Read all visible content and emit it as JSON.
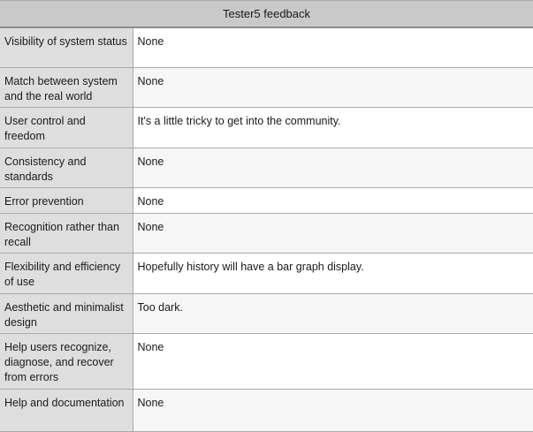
{
  "table": {
    "title": "Tester5 feedback",
    "rows": [
      {
        "heuristic": "Visibility of system status",
        "feedback": "None"
      },
      {
        "heuristic": "Match between system and the real world",
        "feedback": "None"
      },
      {
        "heuristic": "User control and freedom",
        "feedback": "It's a little tricky to get into the community."
      },
      {
        "heuristic": "Consistency and standards",
        "feedback": "None"
      },
      {
        "heuristic": "Error prevention",
        "feedback": "None"
      },
      {
        "heuristic": "Recognition rather than recall",
        "feedback": "None"
      },
      {
        "heuristic": "Flexibility and efficiency of use",
        "feedback": "Hopefully history will have a bar graph display."
      },
      {
        "heuristic": "Aesthetic and minimalist design",
        "feedback": "Too dark."
      },
      {
        "heuristic": "Help users recognize, diagnose, and recover from errors",
        "feedback": "None"
      },
      {
        "heuristic": "Help and documentation",
        "feedback": "None"
      }
    ]
  }
}
